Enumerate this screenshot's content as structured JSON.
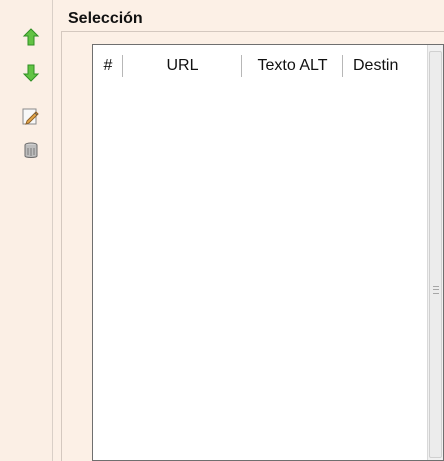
{
  "panel": {
    "title": "Selección"
  },
  "toolbar": {
    "buttons": [
      {
        "name": "move-up",
        "icon": "up-arrow-icon"
      },
      {
        "name": "move-down",
        "icon": "down-arrow-icon"
      },
      {
        "name": "edit",
        "icon": "edit-icon"
      },
      {
        "name": "delete",
        "icon": "trash-icon"
      }
    ]
  },
  "table": {
    "columns": [
      "#",
      "URL",
      "Texto ALT",
      "Destin"
    ]
  }
}
